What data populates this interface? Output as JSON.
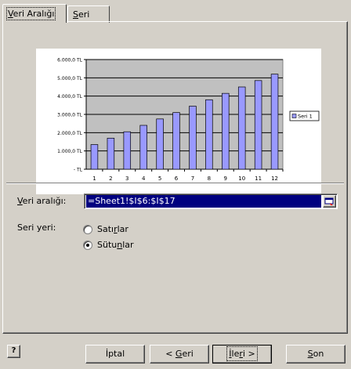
{
  "tabs": [
    {
      "label_pre": "",
      "label_u": "V",
      "label_post": "eri Aralığı"
    },
    {
      "label_pre": "",
      "label_u": "S",
      "label_post": "eri"
    }
  ],
  "chart_data": {
    "type": "bar",
    "categories": [
      "1",
      "2",
      "3",
      "4",
      "5",
      "6",
      "7",
      "8",
      "9",
      "10",
      "11",
      "12"
    ],
    "series": [
      {
        "name": "Seri 1",
        "values": [
          1350,
          1700,
          2050,
          2400,
          2750,
          3100,
          3450,
          3800,
          4150,
          4500,
          4850,
          5200
        ]
      }
    ],
    "ylim": [
      0,
      6000
    ],
    "yticks": [
      0,
      1000,
      2000,
      3000,
      4000,
      5000,
      6000
    ],
    "ytick_labels": [
      "-   TL",
      "1.000,0 TL",
      "2.000,0 TL",
      "3.000,0 TL",
      "4.000,0 TL",
      "5.000,0 TL",
      "6.000,0 TL"
    ],
    "legend_position": "right",
    "grid": true,
    "colors": {
      "bar_fill": "#9999ff",
      "bar_stroke": "#000000",
      "plot_bg": "#c0c0c0"
    }
  },
  "form": {
    "range_label_u": "V",
    "range_label_rest": "eri aralığı:",
    "range_value": "=Sheet1!$I$6:$I$17",
    "series_in_label": "Seri yeri:",
    "rows_pre": "Satı",
    "rows_u": "r",
    "rows_post": "lar",
    "cols_pre": "Sütu",
    "cols_u": "n",
    "cols_post": "lar",
    "selected": "columns"
  },
  "buttons": {
    "help": "?",
    "cancel": "İptal",
    "back_pre": "< ",
    "back_u": "G",
    "back_post": "eri",
    "next_pre": "",
    "next_u": "İ",
    "next_mid": "le",
    "next_u2": "r",
    "next_post": "i >",
    "finish_u": "S",
    "finish_post": "on"
  }
}
